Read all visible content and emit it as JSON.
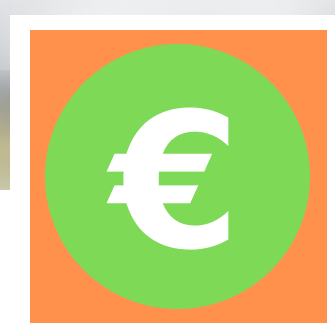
{
  "graphic": {
    "symbol": "€",
    "icon_name": "euro-icon",
    "colors": {
      "panel": "#ff914d",
      "coin": "#7ed957",
      "symbol": "#ffffff",
      "frame": "#ffffff"
    }
  }
}
